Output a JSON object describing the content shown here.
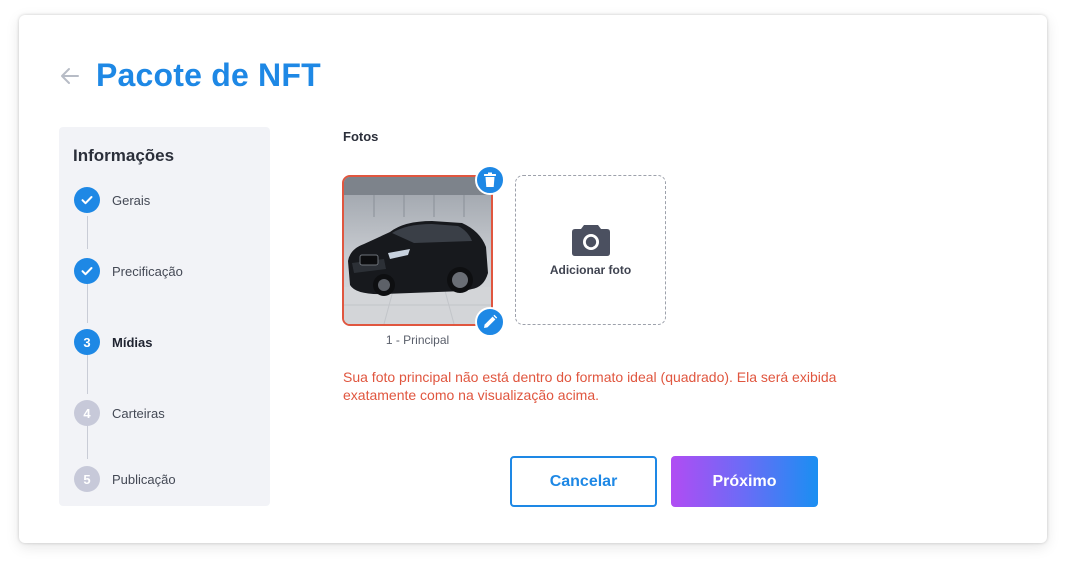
{
  "header": {
    "title": "Pacote de NFT",
    "back_icon": "arrow-left-icon"
  },
  "stepper": {
    "title": "Informações",
    "steps": [
      {
        "number": "1",
        "label": "Gerais",
        "state": "done"
      },
      {
        "number": "2",
        "label": "Precificação",
        "state": "done"
      },
      {
        "number": "3",
        "label": "Mídias",
        "state": "active"
      },
      {
        "number": "4",
        "label": "Carteiras",
        "state": "pending"
      },
      {
        "number": "5",
        "label": "Publicação",
        "state": "pending"
      }
    ]
  },
  "photos": {
    "section_label": "Fotos",
    "main_caption": "1 - Principal",
    "add_label": "Adicionar foto",
    "delete_icon": "trash-icon",
    "edit_icon": "pencil-icon",
    "add_icon": "camera-icon"
  },
  "warning": "Sua foto principal não está dentro do formato ideal (quadrado). Ela será exibida exatamente como na visualização acima.",
  "actions": {
    "cancel_label": "Cancelar",
    "next_label": "Próximo"
  },
  "colors": {
    "primary": "#1e88e5",
    "warning": "#e0563f",
    "gradient_start": "#b14cf3",
    "gradient_end": "#1a8ff2",
    "pending_step": "#c7c9d9"
  }
}
